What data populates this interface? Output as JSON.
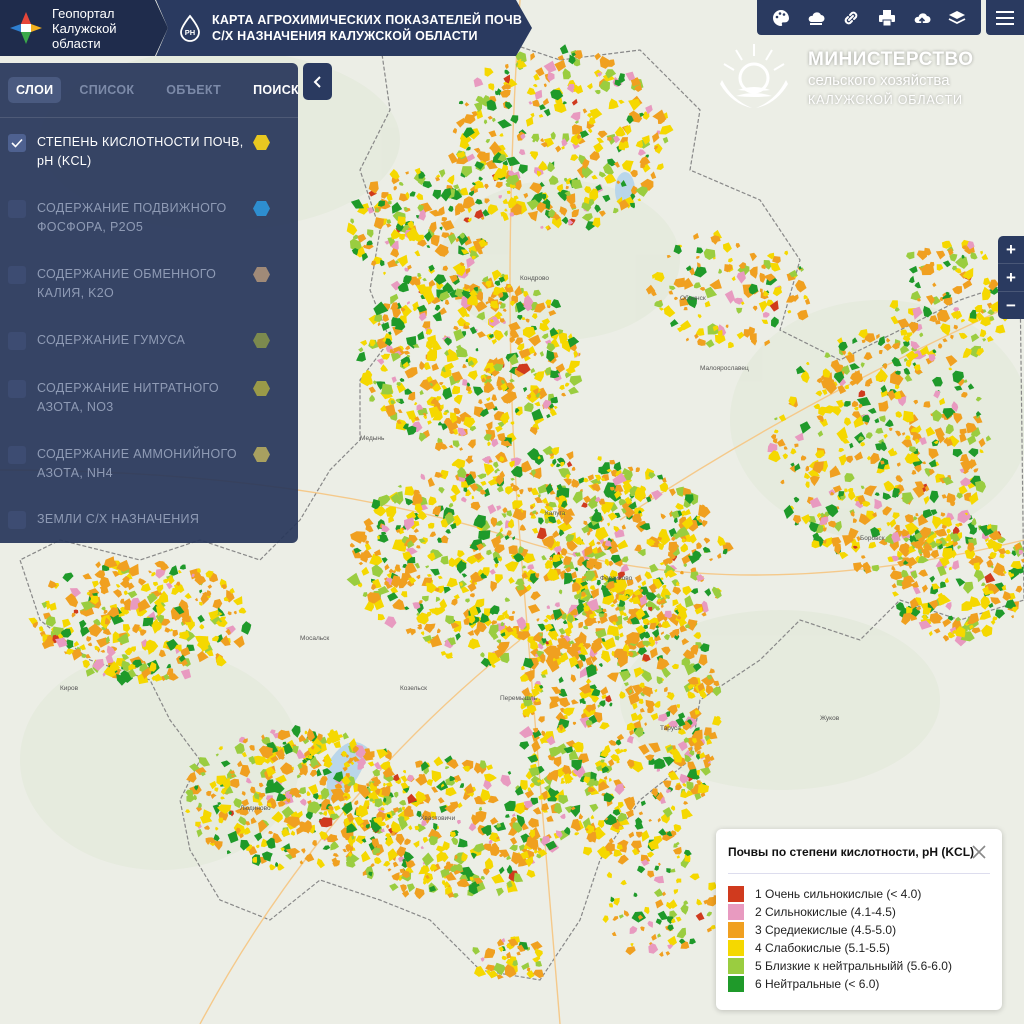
{
  "header": {
    "brand_lines": [
      "Геопортал",
      "Калужской",
      "области"
    ],
    "title_lines": [
      "КАРТА АГРОХИМИЧЕСКИХ ПОКАЗАТЕЛЕЙ ПОЧВ",
      "С/Х НАЗНАЧЕНИЯ КАЛУЖСКОЙ ОБЛАСТИ"
    ],
    "ph_icon_text": "PH"
  },
  "toolbar": {
    "icons": [
      "palette-icon",
      "cloud-basemap-icon",
      "link-icon",
      "print-icon",
      "upload-icon",
      "layers-icon"
    ],
    "menu_icon": "hamburger-icon"
  },
  "ministry": {
    "line1": "МИНИСТЕРСТВО",
    "line2": "сельского хозяйства",
    "line3": "КАЛУЖСКОЙ ОБЛАСТИ"
  },
  "panel": {
    "tabs": [
      {
        "label": "СЛОИ",
        "active": true
      },
      {
        "label": "СПИСОК",
        "active": false
      },
      {
        "label": "ОБЪЕКТ",
        "active": false
      },
      {
        "label": "ПОИСК",
        "active": false
      }
    ],
    "layers": [
      {
        "label": "СТЕПЕНЬ КИСЛОТНОСТИ ПОЧВ, pH (KCL)",
        "checked": true,
        "color": "#e8c820"
      },
      {
        "label": "СОДЕРЖАНИЕ ПОДВИЖНОГО ФОСФОРА, P2O5",
        "checked": false,
        "color": "#2e8ecf"
      },
      {
        "label": "СОДЕРЖАНИЕ ОБМЕННОГО КАЛИЯ, K2O",
        "checked": false,
        "color": "#a08a78"
      },
      {
        "label": "СОДЕРЖАНИЕ ГУМУСА",
        "checked": false,
        "color": "#7c8a4e"
      },
      {
        "label": "СОДЕРЖАНИЕ НИТРАТНОГО АЗОТА, NO3",
        "checked": false,
        "color": "#9a9a48"
      },
      {
        "label": "СОДЕРЖАНИЕ АММОНИЙНОГО АЗОТА, NH4",
        "checked": false,
        "color": "#a8a060"
      },
      {
        "label": "ЗЕМЛИ С/Х НАЗНАЧЕНИЯ",
        "checked": false,
        "color": ""
      }
    ]
  },
  "zoom": {
    "buttons": [
      "+",
      "+",
      "−"
    ]
  },
  "legend": {
    "title": "Почвы по степени кислотности, pH (KCL)",
    "items": [
      {
        "label": "1 Очень сильнокислые (< 4.0)",
        "color": "#d03a1e"
      },
      {
        "label": "2 Сильнокислые (4.1-4.5)",
        "color": "#e89ac0"
      },
      {
        "label": "3 Средиекислые (4.5-5.0)",
        "color": "#f0a020"
      },
      {
        "label": "4 Слабокислые (5.1-5.5)",
        "color": "#f5d800"
      },
      {
        "label": "5 Близкие к нейтральныйй (5.6-6.0)",
        "color": "#9acd40"
      },
      {
        "label": "6 Нейтральные (< 6.0)",
        "color": "#1f9a2a"
      }
    ]
  }
}
